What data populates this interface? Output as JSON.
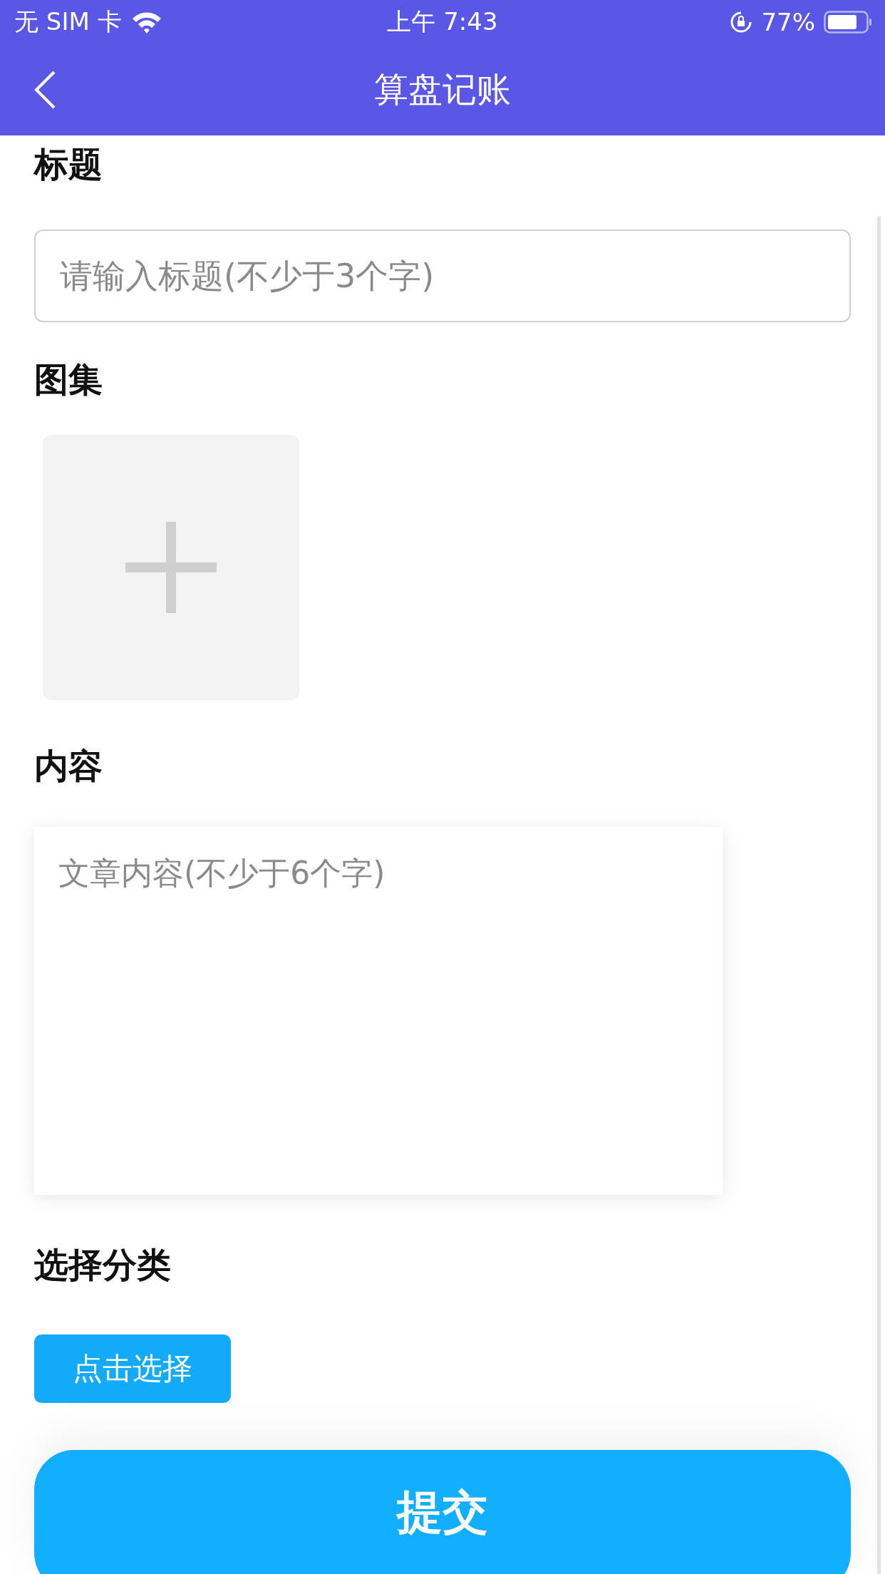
{
  "status_bar": {
    "carrier": "无 SIM 卡",
    "time": "上午 7:43",
    "battery": "77%"
  },
  "nav_bar": {
    "title": "算盘记账"
  },
  "form": {
    "title_label": "标题",
    "title_placeholder": "请输入标题(不少于3个字)",
    "gallery_label": "图集",
    "content_label": "内容",
    "content_placeholder": "文章内容(不少于6个字)",
    "category_label": "选择分类",
    "category_button": "点击选择",
    "submit_button": "提交"
  }
}
